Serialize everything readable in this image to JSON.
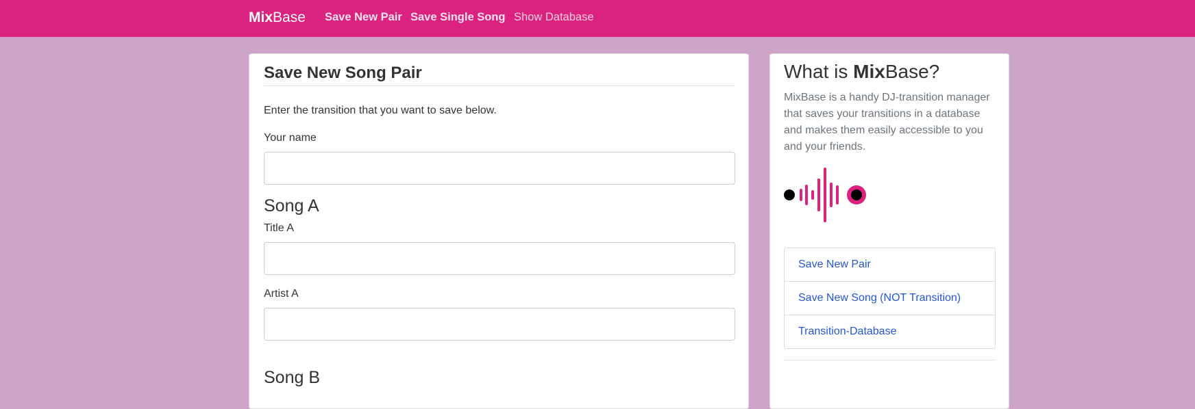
{
  "navbar": {
    "brand_bold": "Mix",
    "brand_rest": "Base",
    "links": [
      "Save New Pair",
      "Save Single Song",
      "Show Database"
    ]
  },
  "main": {
    "title": "Save New Song Pair",
    "intro": "Enter the transition that you want to save below.",
    "name_label": "Your name",
    "name_value": "",
    "song_a_heading": "Song A",
    "title_a_label": "Title A",
    "title_a_value": "",
    "artist_a_label": "Artist A",
    "artist_a_value": "",
    "song_b_heading": "Song B"
  },
  "sidebar": {
    "title_prefix": "What is ",
    "title_bold": "Mix",
    "title_suffix": "Base?",
    "description": "MixBase is a handy DJ-transition manager that saves your transitions in a database and makes them easily accessible to you and your friends.",
    "logo_icon": "soundwave-icon",
    "links": [
      "Save New Pair",
      "Save New Song (NOT Transition)",
      "Transition-Database"
    ]
  },
  "colors": {
    "navbar": "#dc227f",
    "background": "#cea5c8",
    "link": "#2356d6",
    "logo_accent": "#dc227f"
  }
}
